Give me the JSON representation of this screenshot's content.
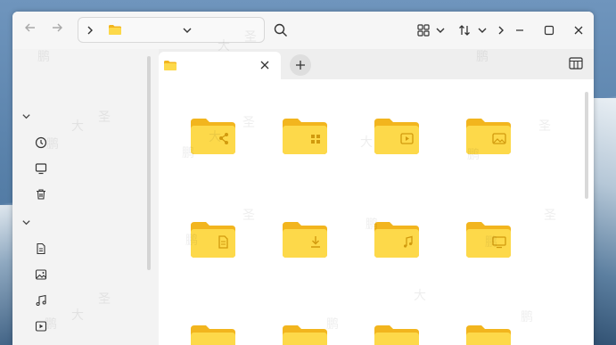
{
  "window": {
    "back_icon": "arrow-left-icon",
    "forward_icon": "arrow-right-icon",
    "address": {
      "chevron": "chevron-right-icon",
      "folder_icon": "folder-icon",
      "path_text": "",
      "dropdown_icon": "chevron-down-icon"
    },
    "search_icon": "search-icon",
    "view_mode_icon": "grid-view-icon",
    "sort_icon": "sort-icon",
    "more_icon": "chevron-right-icon",
    "minimize_icon": "minimize-icon",
    "maximize_icon": "maximize-icon",
    "close_icon": "close-icon"
  },
  "sidebar": {
    "sections": [
      {
        "collapse_icon": "chevron-down-icon",
        "items": [
          {
            "icon": "clock-icon",
            "label": ""
          },
          {
            "icon": "monitor-icon",
            "label": ""
          },
          {
            "icon": "trash-icon",
            "label": ""
          }
        ]
      },
      {
        "collapse_icon": "chevron-down-icon",
        "items": [
          {
            "icon": "document-icon",
            "label": ""
          },
          {
            "icon": "image-icon",
            "label": ""
          },
          {
            "icon": "music-icon",
            "label": ""
          },
          {
            "icon": "video-icon",
            "label": ""
          }
        ]
      }
    ]
  },
  "tabs": [
    {
      "icon": "folder-icon",
      "label": "",
      "close_icon": "close-icon"
    }
  ],
  "add_tab_icon": "plus-icon",
  "panel_toggle_icon": "sidebar-panel-icon",
  "folders": [
    {
      "badge": "share-icon",
      "name": ""
    },
    {
      "badge": "apps-icon",
      "name": ""
    },
    {
      "badge": "video-icon",
      "name": ""
    },
    {
      "badge": "image-icon",
      "name": ""
    },
    {
      "badge": "document-icon",
      "name": ""
    },
    {
      "badge": "download-icon",
      "name": ""
    },
    {
      "badge": "music-icon",
      "name": ""
    },
    {
      "badge": "desktop-icon",
      "name": ""
    },
    {
      "badge": "",
      "name": ""
    },
    {
      "badge": "",
      "name": ""
    },
    {
      "badge": "",
      "name": ""
    },
    {
      "badge": "",
      "name": ""
    }
  ],
  "colors": {
    "folder_back": "#f2b51e",
    "folder_front": "#fdd94a",
    "badge": "#d19a0e"
  }
}
